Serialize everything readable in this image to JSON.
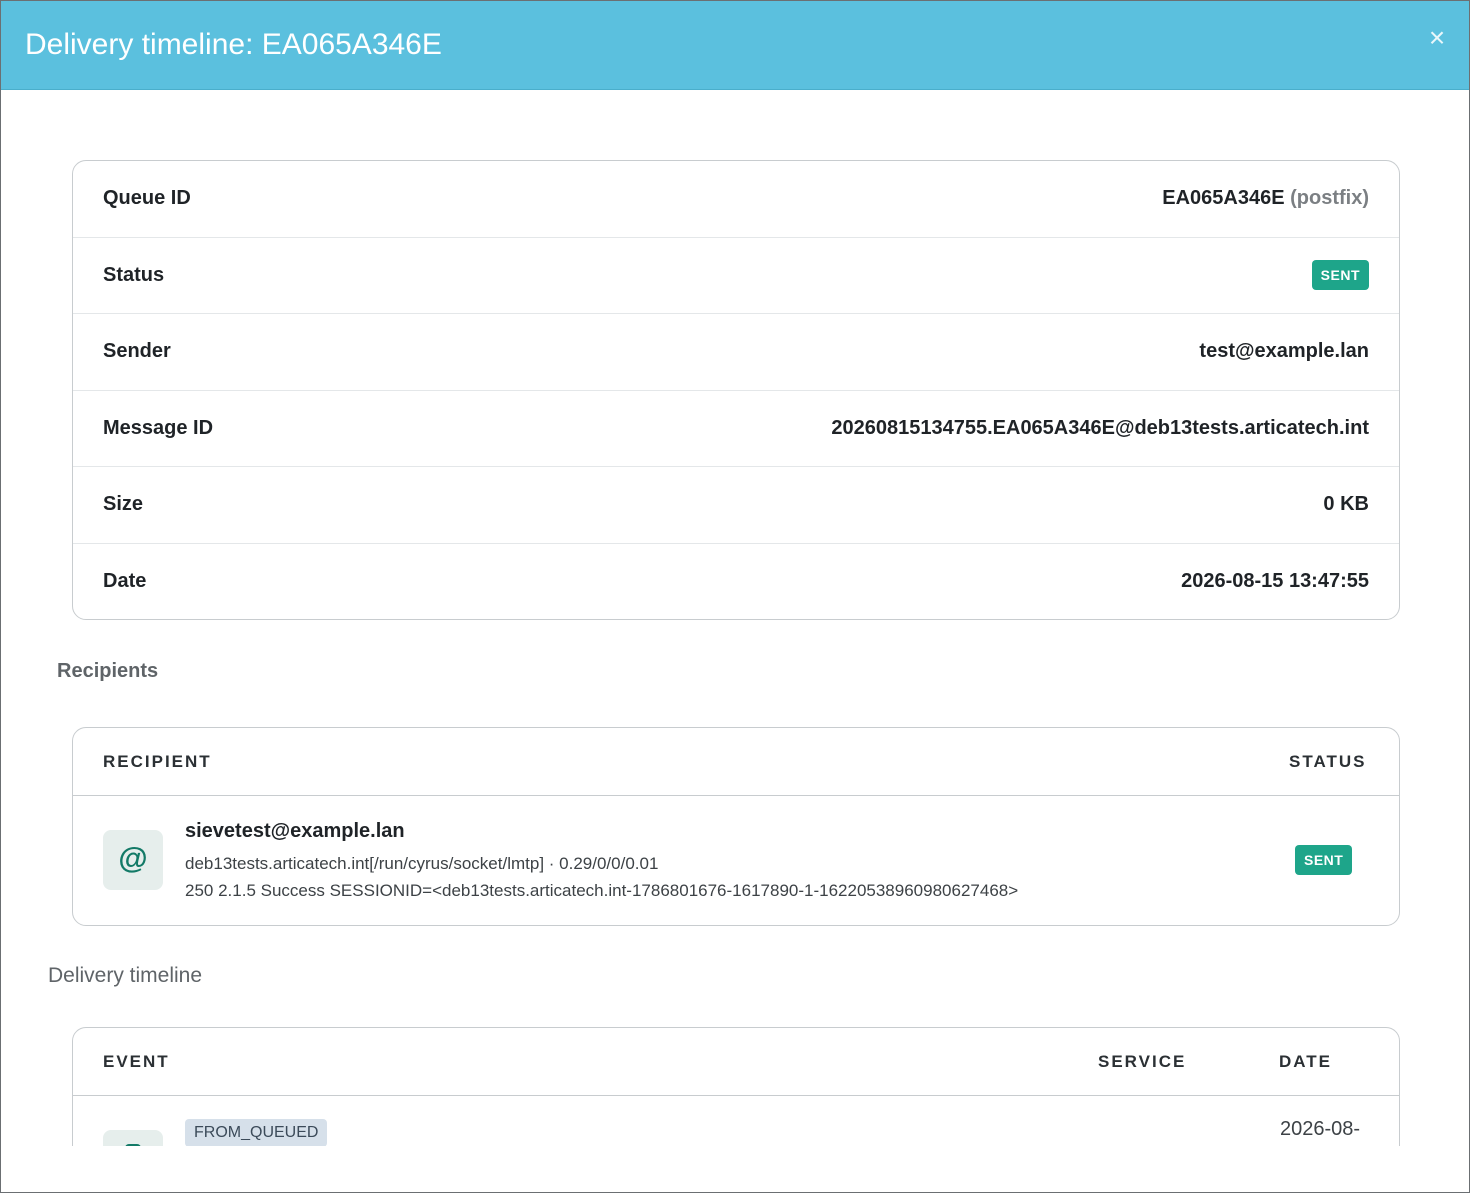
{
  "modal": {
    "title": "Delivery timeline: EA065A346E",
    "close_symbol": "×"
  },
  "info": {
    "rows": [
      {
        "label": "Queue ID",
        "value": "EA065A346E",
        "suffix": "(postfix)"
      },
      {
        "label": "Status",
        "value": "SENT"
      },
      {
        "label": "Sender",
        "value": "test@example.lan"
      },
      {
        "label": "Message ID",
        "value": "20260815134755.EA065A346E@deb13tests.articatech.int"
      },
      {
        "label": "Size",
        "value": "0 KB"
      },
      {
        "label": "Date",
        "value": "2026-08-15 13:47:55"
      }
    ]
  },
  "recipients": {
    "section_title": "Recipients",
    "columns": {
      "recipient": "RECIPIENT",
      "status": "STATUS"
    },
    "items": [
      {
        "icon": "at-icon",
        "icon_glyph": "@",
        "email": "sievetest@example.lan",
        "relay": "deb13tests.articatech.int[/run/cyrus/socket/lmtp] · 0.29/0/0/0.01",
        "response": "250 2.1.5 Success SESSIONID=<deb13tests.articatech.int-1786801676-1617890-1-16220538960980627468>",
        "status": "SENT"
      }
    ]
  },
  "timeline": {
    "section_title": "Delivery timeline",
    "columns": {
      "event": "EVENT",
      "service": "SERVICE",
      "date": "DATE"
    },
    "events": [
      {
        "icon": "queue-icon",
        "tag": "FROM_QUEUED",
        "service": "",
        "date": "2026-08-"
      }
    ]
  },
  "colors": {
    "header": "#5bc0de",
    "badge_sent": "#1ea58a",
    "icon_bg": "#e6eeec",
    "icon_fg": "#137a67",
    "tag_bg": "#d6e0ea"
  }
}
